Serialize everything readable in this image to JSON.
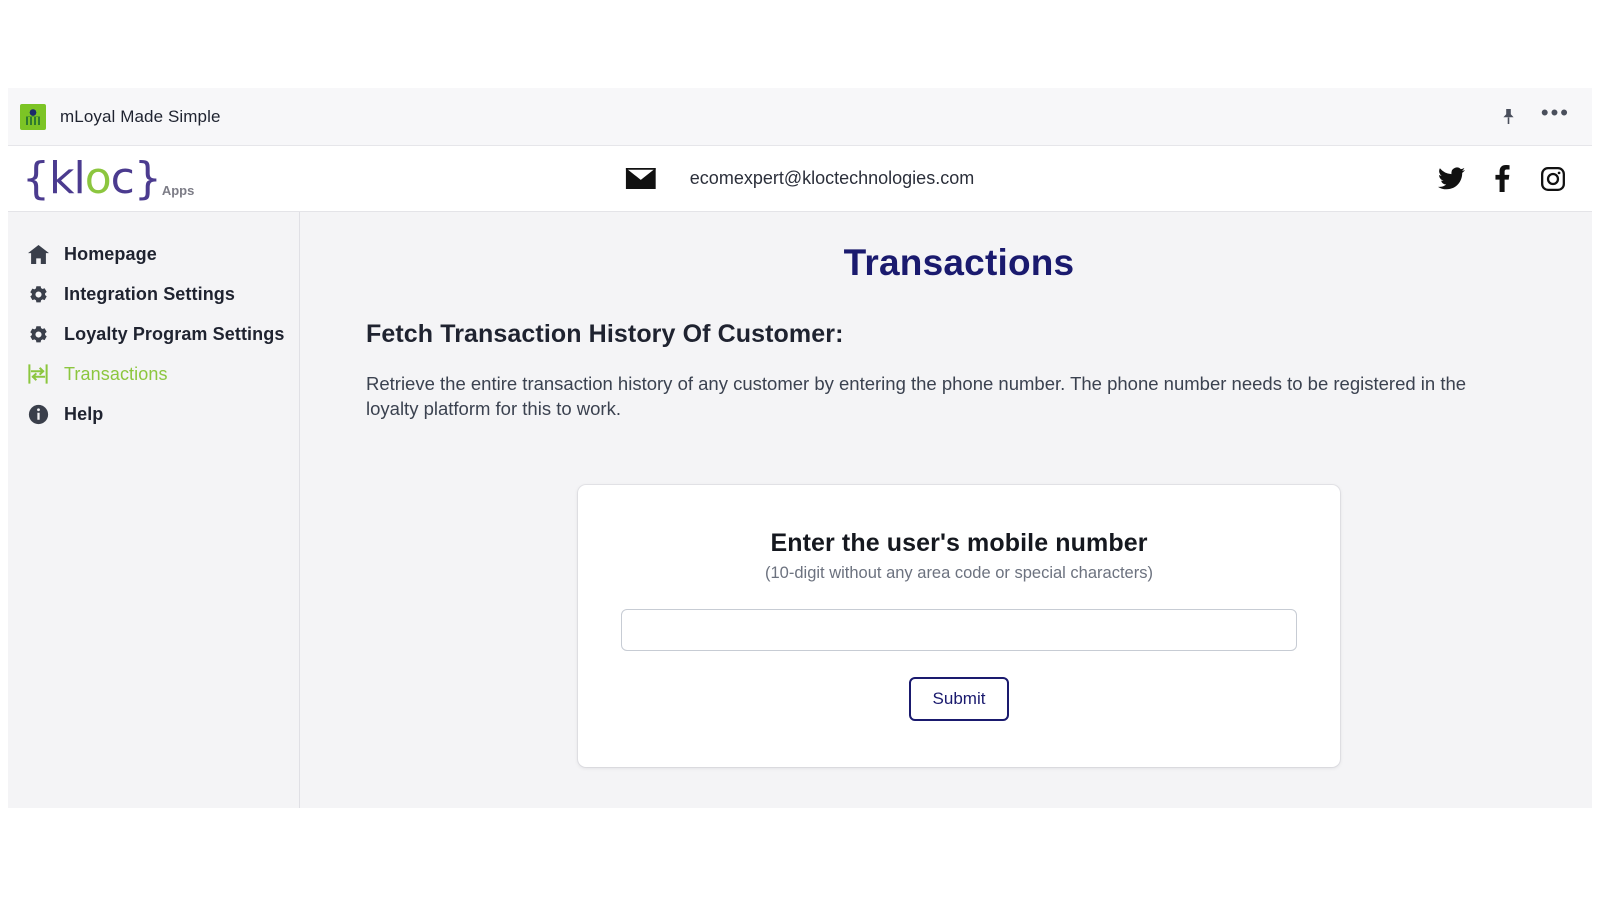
{
  "chrome": {
    "title": "mLoyal Made Simple",
    "favicon_name": "mloyal-favicon",
    "pin_icon": "pin-icon",
    "more_icon": "more-options-icon",
    "more_label": "•••"
  },
  "header": {
    "logo": {
      "brace_open": "{",
      "k": "k",
      "l": "l",
      "o": "o",
      "c": "c",
      "brace_close": "}",
      "suffix": "Apps",
      "accent_color": "#8cc63f",
      "brand_color": "#4b3b8f"
    },
    "mail_icon": "mail-icon",
    "email": "ecomexpert@kloctechnologies.com",
    "socials": [
      {
        "name": "twitter-icon",
        "label": "Twitter"
      },
      {
        "name": "facebook-icon",
        "label": "Facebook"
      },
      {
        "name": "instagram-icon",
        "label": "Instagram"
      }
    ]
  },
  "sidebar": {
    "items": [
      {
        "label": "Homepage",
        "icon": "home-icon",
        "active": false
      },
      {
        "label": "Integration Settings",
        "icon": "gear-icon",
        "active": false
      },
      {
        "label": "Loyalty Program Settings",
        "icon": "gear-icon",
        "active": false
      },
      {
        "label": "Transactions",
        "icon": "exchange-arrows-icon",
        "active": true
      },
      {
        "label": "Help",
        "icon": "info-icon",
        "active": false
      }
    ],
    "active_color": "#8cc63f"
  },
  "main": {
    "page_title": "Transactions",
    "page_title_color": "#1a1a6e",
    "section_title": "Fetch Transaction History Of Customer:",
    "section_description": "Retrieve the entire transaction history of any customer by entering the phone number. The phone number needs to be registered in the loyalty platform for this to work.",
    "card": {
      "title": "Enter the user's mobile number",
      "subtitle": "(10-digit without any area code or special characters)",
      "input_value": "",
      "input_placeholder": "",
      "submit_label": "Submit",
      "submit_color": "#1a1a6e"
    }
  }
}
